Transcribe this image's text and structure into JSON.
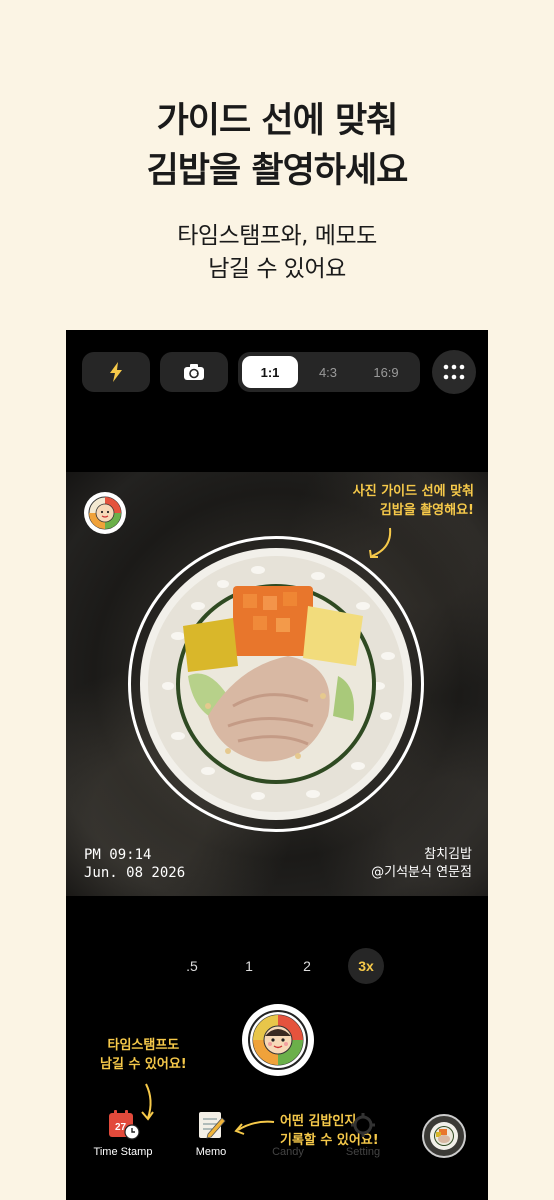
{
  "headline": {
    "line1": "가이드 선에 맞춰",
    "line2": "김밥을 촬영하세요"
  },
  "subhead": {
    "line1": "타임스탬프와, 메모도",
    "line2": "남길 수 있어요"
  },
  "camera": {
    "ratios": [
      "1:1",
      "4:3",
      "16:9"
    ],
    "selected_ratio": "1:1",
    "icons": {
      "flash": "flash-icon",
      "flip": "camera-flip-icon",
      "menu": "more-grid-icon"
    }
  },
  "viewfinder": {
    "guide_note_line1": "사진 가이드 선에 맞춰",
    "guide_note_line2": "김밥을 촬영해요!",
    "stamp_time": "PM 09:14",
    "stamp_date": "Jun. 08 2026",
    "memo_title": "참치김밥",
    "memo_place": "@기석분식 연문점"
  },
  "zoom": {
    "options": [
      ".5",
      "1",
      "2",
      "3x"
    ],
    "selected": "3x"
  },
  "callouts": {
    "timestamp_line1": "타임스탬프도",
    "timestamp_line2": "남길 수 있어요!",
    "memo_line1": "어떤 김밥인지",
    "memo_line2": "기록할 수 있어요!"
  },
  "tabs": {
    "timestamp": "Time Stamp",
    "memo": "Memo",
    "candy": "Candy",
    "setting": "Setting",
    "calendar_day": "27"
  },
  "colors": {
    "background": "#fbf4e4",
    "accent": "#f6c94a",
    "phone": "#000000"
  }
}
